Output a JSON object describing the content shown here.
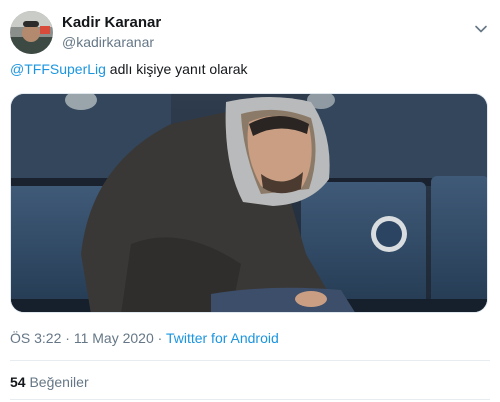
{
  "tweet": {
    "display_name": "Kadir Karanar",
    "handle": "@kadirkaranar",
    "reply_mention": "@TFFSuperLig",
    "reply_text": " adlı kişiye yanıt olarak",
    "time": "ÖS 3:22",
    "separator": " · ",
    "date": "11 May 2020",
    "source": "Twitter for Android",
    "likes_count": "54",
    "likes_label": "Beğeniler"
  },
  "icons": {
    "menu": "chevron-down-icon"
  },
  "colors": {
    "link": "#1b95e0",
    "secondary_text": "#657786",
    "primary_text": "#14171a"
  }
}
